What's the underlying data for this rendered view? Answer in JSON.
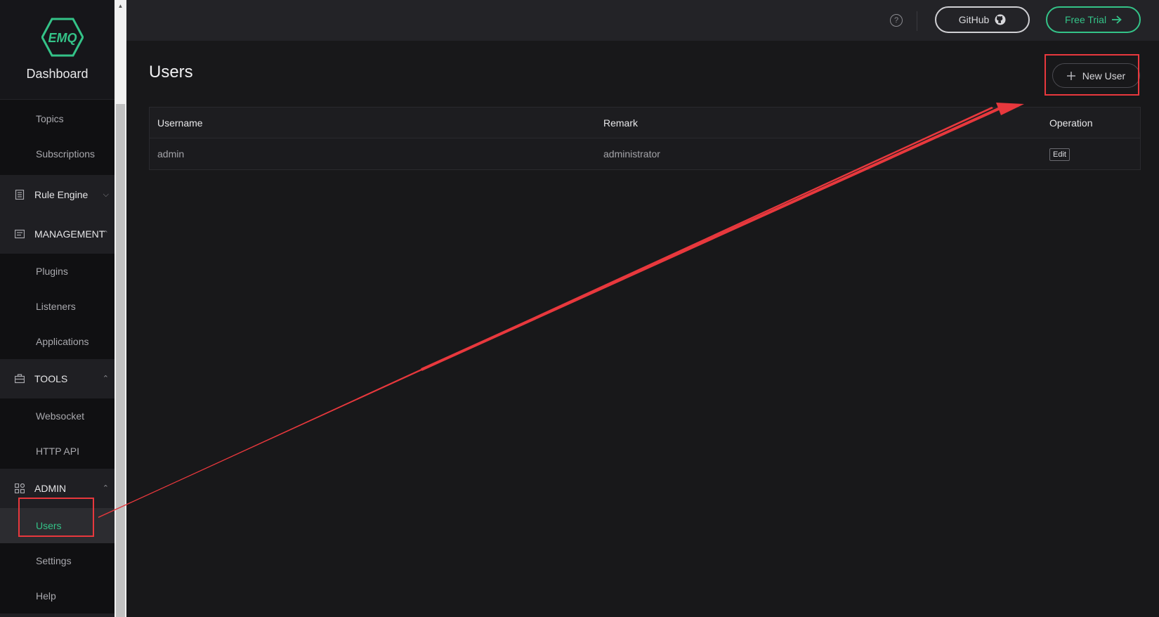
{
  "brand": {
    "logo_text": "EMQ",
    "title": "Dashboard"
  },
  "sidebar": {
    "items": [
      {
        "label": "Topics"
      },
      {
        "label": "Subscriptions"
      }
    ],
    "rule_engine": {
      "label": "Rule Engine"
    },
    "management": {
      "label": "MANAGEMENT",
      "items": [
        {
          "label": "Plugins"
        },
        {
          "label": "Listeners"
        },
        {
          "label": "Applications"
        }
      ]
    },
    "tools": {
      "label": "TOOLS",
      "items": [
        {
          "label": "Websocket"
        },
        {
          "label": "HTTP API"
        }
      ]
    },
    "admin": {
      "label": "ADMIN",
      "items": [
        {
          "label": "Users",
          "active": true
        },
        {
          "label": "Settings"
        },
        {
          "label": "Help"
        }
      ]
    }
  },
  "header": {
    "help_symbol": "?",
    "github_label": "GitHub",
    "trial_label": "Free Trial"
  },
  "main": {
    "title": "Users",
    "new_user_label": "New User",
    "table": {
      "columns": [
        "Username",
        "Remark",
        "Operation"
      ],
      "rows": [
        {
          "username": "admin",
          "remark": "administrator",
          "action": "Edit"
        }
      ]
    }
  },
  "colors": {
    "accent": "#34c388",
    "annotation": "#e8383d",
    "background": "#18181a",
    "sidebar": "#101012"
  }
}
